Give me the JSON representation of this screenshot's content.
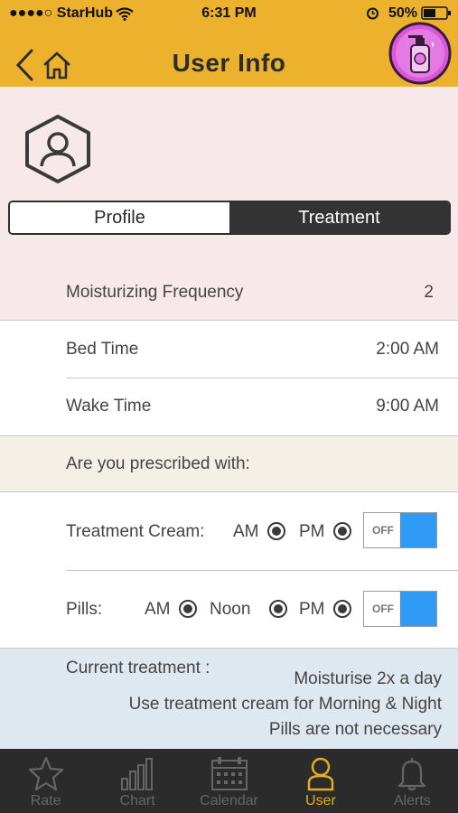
{
  "status_bar": {
    "carrier": "●●●●○ StarHub",
    "time": "6:31 PM",
    "battery": "50%"
  },
  "header": {
    "title": "User Info"
  },
  "segments": {
    "profile": "Profile",
    "treatment": "Treatment",
    "active": "Treatment"
  },
  "settings": {
    "moisturizing_label": "Moisturizing Frequency",
    "moisturizing_value": "2",
    "bed_time_label": "Bed Time",
    "bed_time_value": "2:00 AM",
    "wake_time_label": "Wake Time",
    "wake_time_value": "9:00 AM",
    "prescribed_label": "Are you prescribed with:"
  },
  "treatment_cream": {
    "label": "Treatment Cream:",
    "am_label": "AM",
    "pm_label": "PM",
    "toggle_text": "OFF"
  },
  "pills": {
    "label": "Pills:",
    "am_label": "AM",
    "noon_label": "Noon",
    "pm_label": "PM",
    "toggle_text": "OFF"
  },
  "current_treatment": {
    "label": "Current treatment :",
    "line1": "Moisturise 2x a day",
    "line2": "Use treatment cream for Morning & Night",
    "line3": "Pills are not necessary"
  },
  "tabbar": {
    "items": [
      "Rate",
      "Chart",
      "Calendar",
      "User",
      "Alerts"
    ],
    "active": "User"
  },
  "colors": {
    "header": "#ecb22e",
    "accent": "#e6ac1f",
    "toggle_blue": "#2f9bf5",
    "tabbar": "#2b2b2b"
  }
}
